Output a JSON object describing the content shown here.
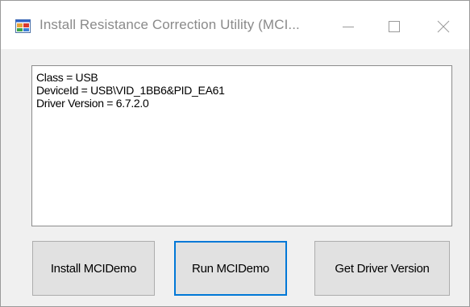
{
  "window": {
    "title": "Install Resistance Correction Utility (MCI..."
  },
  "output": {
    "lines": [
      "Class = USB",
      "DeviceId = USB\\VID_1BB6&PID_EA61",
      "Driver Version = 6.7.2.0"
    ]
  },
  "buttons": {
    "install": "Install MCIDemo",
    "run": "Run MCIDemo",
    "get_version": "Get Driver Version"
  },
  "colors": {
    "focus_border": "#0078d7",
    "button_face": "#e1e1e1",
    "window_bg": "#f0f0f0"
  }
}
